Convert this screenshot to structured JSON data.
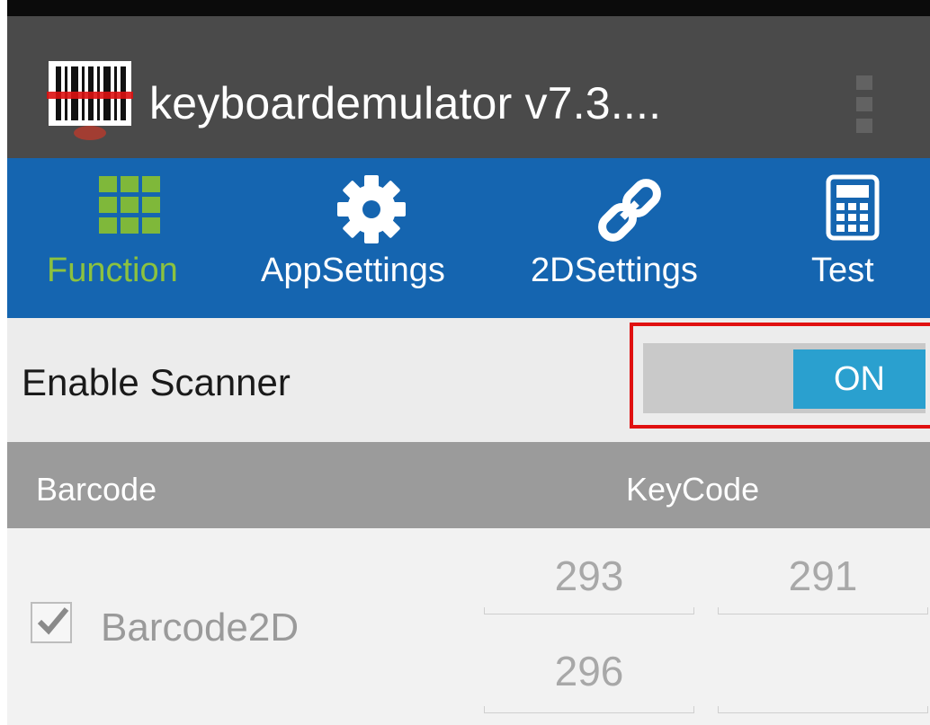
{
  "app": {
    "title": "keyboardemulator v7.3....",
    "icon": "barcode-scanner-icon"
  },
  "tabs": [
    {
      "label": "Function",
      "icon": "grid-icon",
      "active": true,
      "color": "#8cc23f"
    },
    {
      "label": "AppSettings",
      "icon": "gear-icon",
      "active": false
    },
    {
      "label": "2DSettings",
      "icon": "link-icon",
      "active": false
    },
    {
      "label": "Test",
      "icon": "calculator-icon",
      "active": false
    }
  ],
  "enable_scanner": {
    "label": "Enable Scanner",
    "toggle_state": "ON",
    "highlight_color": "#e01010"
  },
  "table": {
    "columns": [
      "Barcode",
      "KeyCode"
    ],
    "rows": [
      {
        "checked": true,
        "label": "Barcode2D",
        "keycodes": [
          "293",
          "291",
          "296",
          ""
        ]
      }
    ]
  },
  "colors": {
    "action_bar": "#4a4a4a",
    "tab_bar": "#1565b0",
    "toggle_on": "#2aa0cf"
  }
}
